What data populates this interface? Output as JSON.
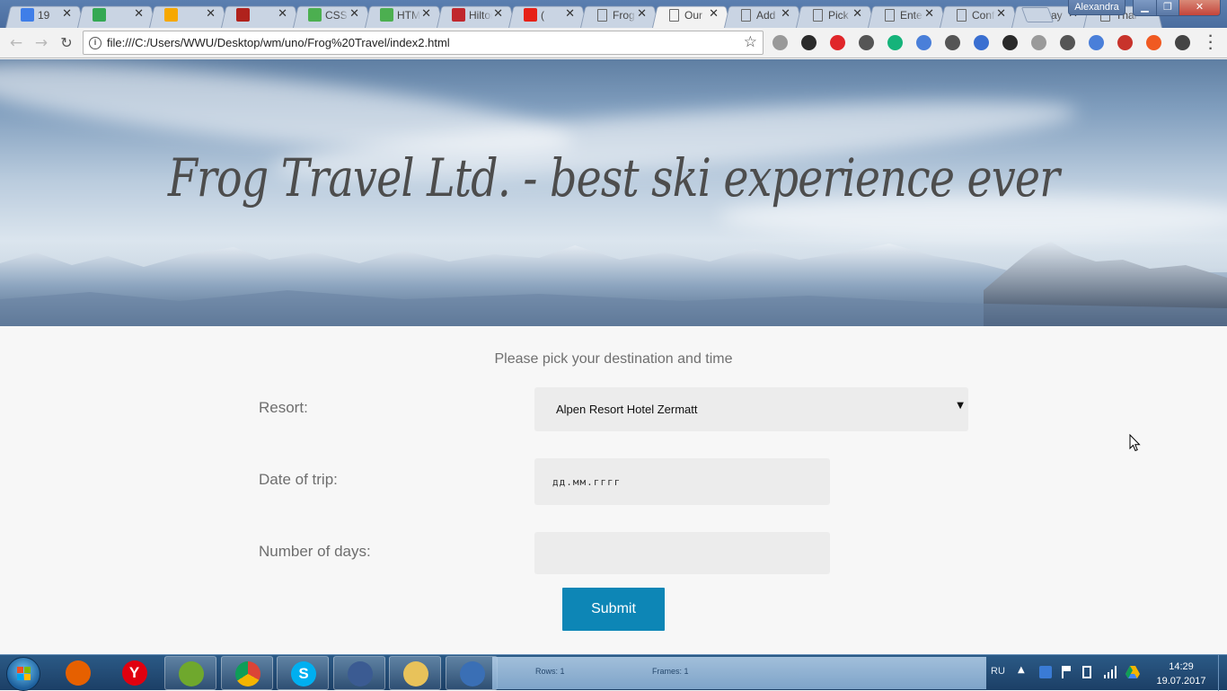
{
  "browser": {
    "tabs": [
      {
        "title": "19",
        "icon": "calendar-icon",
        "color": "#3f7ee8",
        "active": false
      },
      {
        "title": "",
        "icon": "maps-icon",
        "color": "#34a853",
        "active": false
      },
      {
        "title": "",
        "icon": "music-icon",
        "color": "#f6a800",
        "active": false
      },
      {
        "title": "",
        "icon": "info-app-icon",
        "color": "#b0221c",
        "active": false
      },
      {
        "title": "CSS",
        "icon": "w3-icon",
        "color": "#4caf50",
        "active": false
      },
      {
        "title": "HTML",
        "icon": "w3-icon",
        "color": "#4caf50",
        "active": false
      },
      {
        "title": "Hilton",
        "icon": "hilton-icon",
        "color": "#c0272d",
        "active": false
      },
      {
        "title": "(",
        "icon": "youtube-icon",
        "color": "#e62117",
        "active": false
      },
      {
        "title": "Frog",
        "icon": "page-icon",
        "color": "",
        "active": false
      },
      {
        "title": "Our",
        "icon": "page-icon",
        "color": "",
        "active": true
      },
      {
        "title": "Add",
        "icon": "page-icon",
        "color": "",
        "active": false
      },
      {
        "title": "Pick",
        "icon": "page-icon",
        "color": "",
        "active": false
      },
      {
        "title": "Enter",
        "icon": "page-icon",
        "color": "",
        "active": false
      },
      {
        "title": "Conf",
        "icon": "page-icon",
        "color": "",
        "active": false
      },
      {
        "title": "Pay",
        "icon": "page-icon",
        "color": "",
        "active": false
      },
      {
        "title": "Thank",
        "icon": "page-icon",
        "color": "",
        "active": false
      }
    ],
    "profile_name": "Alexandra",
    "url": "file:///C:/Users/WWU/Desktop/wm/uno/Frog%20Travel/index2.html",
    "extensions": [
      "paw-icon",
      "globe-icon",
      "opera-icon",
      "music-clef-icon",
      "grammarly-icon",
      "translate-icon",
      "eye-icon",
      "bookmark-icon",
      "evernote-icon",
      "vpn-icon",
      "lock-off-icon",
      "translate-a-icon",
      "pdf-icon",
      "fire-icon",
      "pen-icon"
    ]
  },
  "hero": {
    "title": "Frog Travel Ltd. - best ski experience ever"
  },
  "form": {
    "subtitle": "Please pick your destination and time",
    "resort_label": "Resort:",
    "resort_value": "Alpen Resort Hotel Zermatt",
    "date_label": "Date of trip:",
    "date_placeholder": "дд.мм.гггг",
    "days_label": "Number of days:",
    "days_value": "",
    "submit_label": "Submit"
  },
  "taskbar": {
    "apps": [
      "firefox-icon",
      "yandex-icon",
      "notepad-icon",
      "chrome-icon",
      "skype-icon",
      "keepass-icon",
      "explorer-icon",
      "tool-icon"
    ],
    "hidden_text_1": "Rows: 1",
    "hidden_text_2": "Frames: 1",
    "language": "RU",
    "time": "14:29",
    "date": "19.07.2017"
  },
  "colors": {
    "submit_bg": "#0d86b6",
    "title_color": "#4d4d4d",
    "field_bg": "#ececec"
  }
}
